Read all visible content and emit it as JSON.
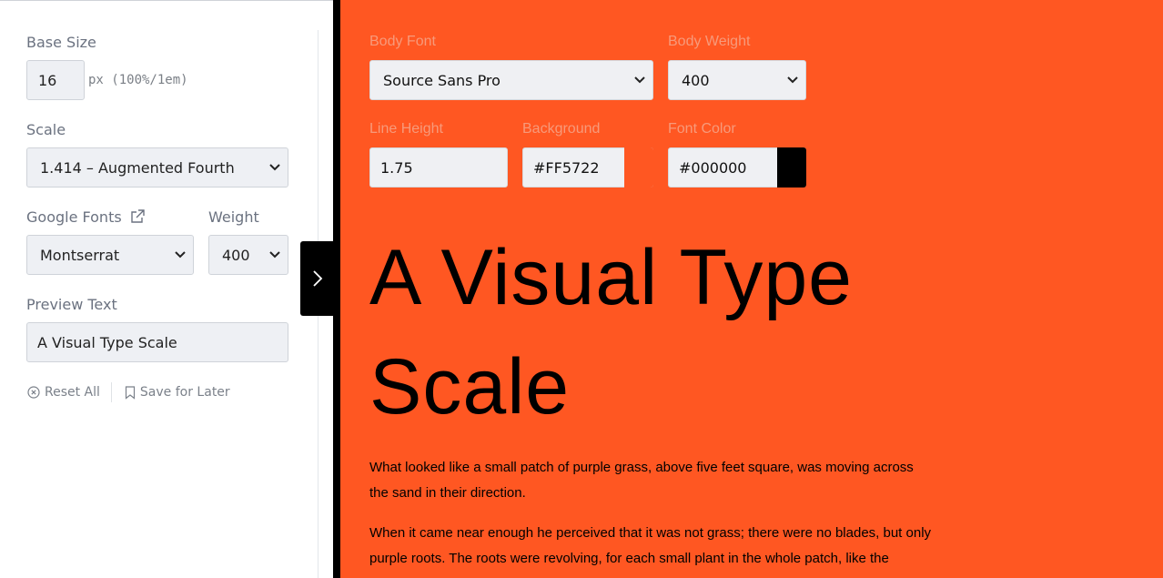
{
  "sidebar": {
    "base_size": {
      "label": "Base Size",
      "value": "16",
      "unit": "px (100%/1em)"
    },
    "scale": {
      "label": "Scale",
      "selected": "1.414 – Augmented Fourth"
    },
    "google_fonts": {
      "label": "Google Fonts",
      "selected": "Montserrat"
    },
    "weight": {
      "label": "Weight",
      "selected": "400"
    },
    "preview_text": {
      "label": "Preview Text",
      "value": "A Visual Type Scale"
    },
    "actions": {
      "reset": "Reset All",
      "save": "Save for Later"
    }
  },
  "preview": {
    "body_font": {
      "label": "Body Font",
      "selected": "Source Sans Pro"
    },
    "body_weight": {
      "label": "Body Weight",
      "selected": "400"
    },
    "line_height": {
      "label": "Line Height",
      "value": "1.75"
    },
    "background": {
      "label": "Background",
      "value": "#FF5722",
      "color": "#FF5722"
    },
    "font_color": {
      "label": "Font Color",
      "value": "#000000",
      "color": "#000000"
    },
    "heading": "A Visual Type Scale",
    "paragraphs": [
      "What looked like a small patch of purple grass, above five feet square, was moving across the sand in their direction.",
      "When it came near enough he perceived that it was not grass; there were no blades, but only purple roots. The roots were revolving, for each small plant in the whole patch, like the"
    ]
  },
  "icons": {
    "external_link": "external-link-icon",
    "reset": "circle-x-icon",
    "save": "bookmark-icon",
    "toggle": "chevron-right-icon",
    "select": "chevron-down-icon"
  }
}
